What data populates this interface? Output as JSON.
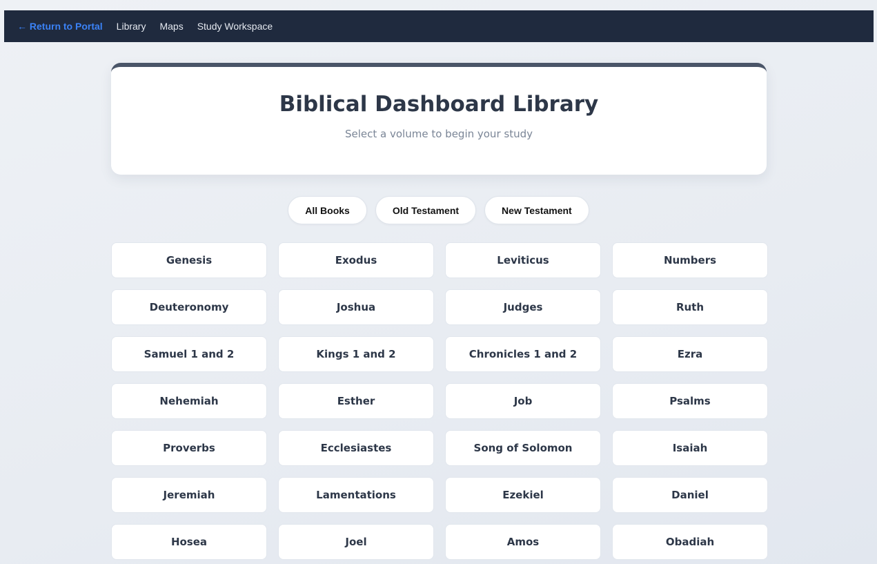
{
  "nav": {
    "back_label": "← Return to Portal",
    "links": [
      "Library",
      "Maps",
      "Study Workspace"
    ]
  },
  "header": {
    "title": "Biblical Dashboard Library",
    "subtitle": "Select a volume to begin your study"
  },
  "filters": [
    "All Books",
    "Old Testament",
    "New Testament"
  ],
  "books": [
    "Genesis",
    "Exodus",
    "Leviticus",
    "Numbers",
    "Deuteronomy",
    "Joshua",
    "Judges",
    "Ruth",
    "Samuel 1 and 2",
    "Kings 1 and 2",
    "Chronicles 1 and 2",
    "Ezra",
    "Nehemiah",
    "Esther",
    "Job",
    "Psalms",
    "Proverbs",
    "Ecclesiastes",
    "Song of Solomon",
    "Isaiah",
    "Jeremiah",
    "Lamentations",
    "Ezekiel",
    "Daniel",
    "Hosea",
    "Joel",
    "Amos",
    "Obadiah"
  ],
  "colors": {
    "nav_bg": "#1f2a3e",
    "accent": "#3b82f6",
    "title": "#2d3748"
  }
}
